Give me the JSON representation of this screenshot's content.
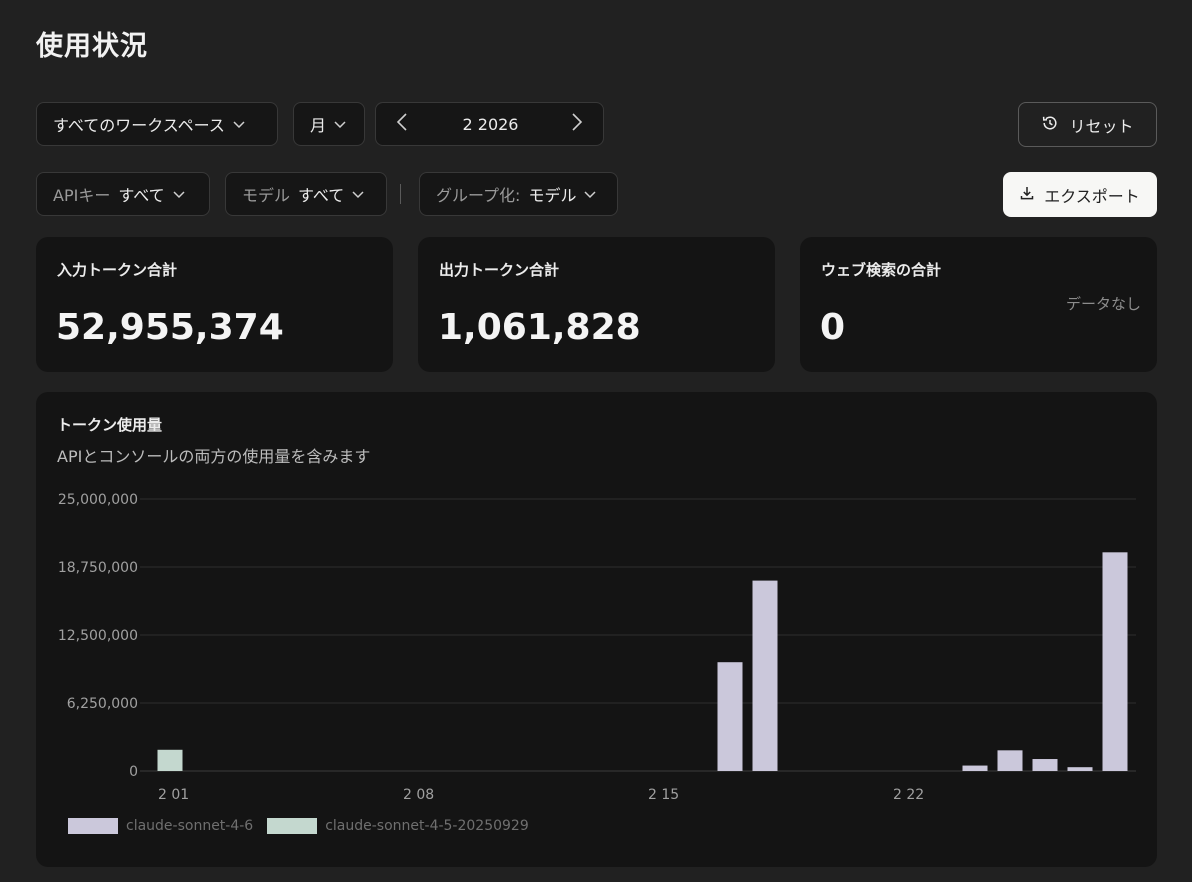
{
  "page": {
    "title": "使用状況"
  },
  "filters": {
    "workspace": "すべてのワークスペース",
    "period": "月",
    "date_label": "2 2026",
    "api_key_label": "APIキー",
    "api_key_value": "すべて",
    "model_label": "モデル",
    "model_value": "すべて",
    "group_label": "グループ化:",
    "group_value": "モデル"
  },
  "actions": {
    "reset": "リセット",
    "export": "エクスポート"
  },
  "stats": [
    {
      "label": "入力トークン合計",
      "value": "52,955,374",
      "note": ""
    },
    {
      "label": "出力トークン合計",
      "value": "1,061,828",
      "note": ""
    },
    {
      "label": "ウェブ検索の合計",
      "value": "0",
      "note": "データなし"
    }
  ],
  "usage_panel": {
    "title": "トークン使用量",
    "subtitle": "APIとコンソールの両方の使用量を含みます"
  },
  "colors": {
    "sonnet46": "#cbc8db",
    "sonnet45": "#c4d8cf",
    "grid": "#2e2e2e",
    "axis": "#a0a0a0"
  },
  "chart_data": {
    "type": "bar",
    "ylim": [
      0,
      25000000
    ],
    "yticks": [
      0,
      6250000,
      12500000,
      18750000,
      25000000
    ],
    "ytick_labels": [
      "0",
      "6,250,000",
      "12,500,000",
      "18,750,000",
      "25,000,000"
    ],
    "xtick_labels": [
      {
        "day": 1,
        "label": "2 01"
      },
      {
        "day": 8,
        "label": "2 08"
      },
      {
        "day": 15,
        "label": "2 15"
      },
      {
        "day": 22,
        "label": "2 22"
      }
    ],
    "x_days": [
      1,
      2,
      3,
      4,
      5,
      6,
      7,
      8,
      9,
      10,
      11,
      12,
      13,
      14,
      15,
      16,
      17,
      18,
      19,
      20,
      21,
      22,
      23,
      24,
      25,
      26,
      27,
      28
    ],
    "grid": true,
    "legend_placement": "bottom-left",
    "series": [
      {
        "name": "claude-sonnet-4-6",
        "values": [
          0,
          0,
          0,
          0,
          0,
          0,
          0,
          0,
          0,
          0,
          0,
          0,
          0,
          0,
          0,
          0,
          10000000,
          17500000,
          0,
          0,
          0,
          0,
          0,
          500000,
          1900000,
          1100000,
          350000,
          20100000
        ]
      },
      {
        "name": "claude-sonnet-4-5-20250929",
        "values": [
          1950000,
          0,
          0,
          0,
          0,
          0,
          0,
          0,
          0,
          0,
          0,
          0,
          0,
          0,
          0,
          0,
          0,
          0,
          0,
          0,
          0,
          0,
          0,
          0,
          0,
          0,
          0,
          0
        ]
      }
    ]
  }
}
